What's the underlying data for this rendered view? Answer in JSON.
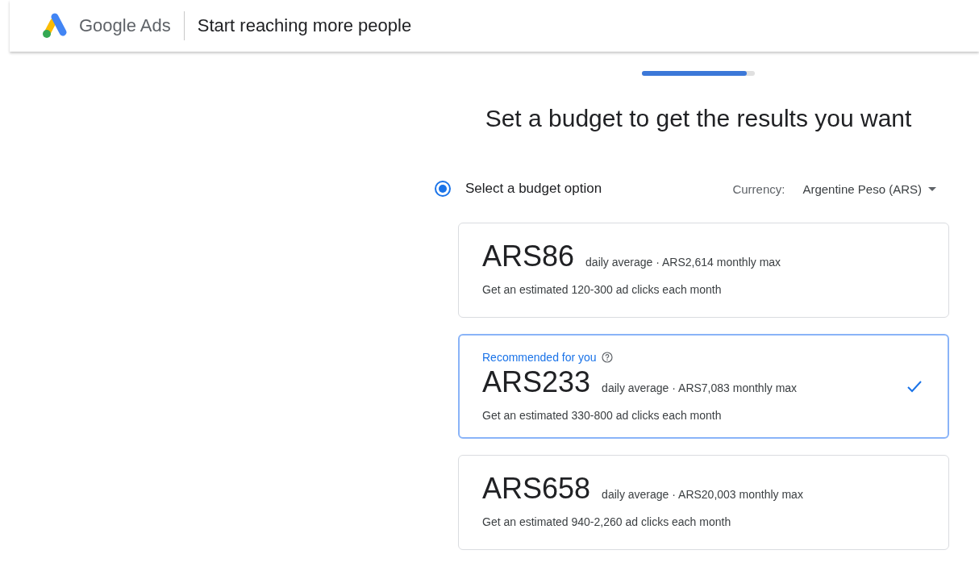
{
  "header": {
    "brand": "Google Ads",
    "title": "Start reaching more people"
  },
  "progress": {
    "level": 0.93
  },
  "heading": "Set a budget to get the results you want",
  "budget_choice": {
    "label": "Select a budget option",
    "selected": true
  },
  "currency": {
    "label": "Currency:",
    "value": "Argentine Peso (ARS)"
  },
  "options": [
    {
      "amount": "ARS86",
      "detail": "daily average · ARS2,614 monthly max",
      "estimate": "Get an estimated 120-300 ad clicks each month",
      "selected": false
    },
    {
      "recommendation": "Recommended for you",
      "amount": "ARS233",
      "detail": "daily average · ARS7,083 monthly max",
      "estimate": "Get an estimated 330-800 ad clicks each month",
      "selected": true
    },
    {
      "amount": "ARS658",
      "detail": "daily average · ARS20,003 monthly max",
      "estimate": "Get an estimated 940-2,260 ad clicks each month",
      "selected": false
    }
  ]
}
